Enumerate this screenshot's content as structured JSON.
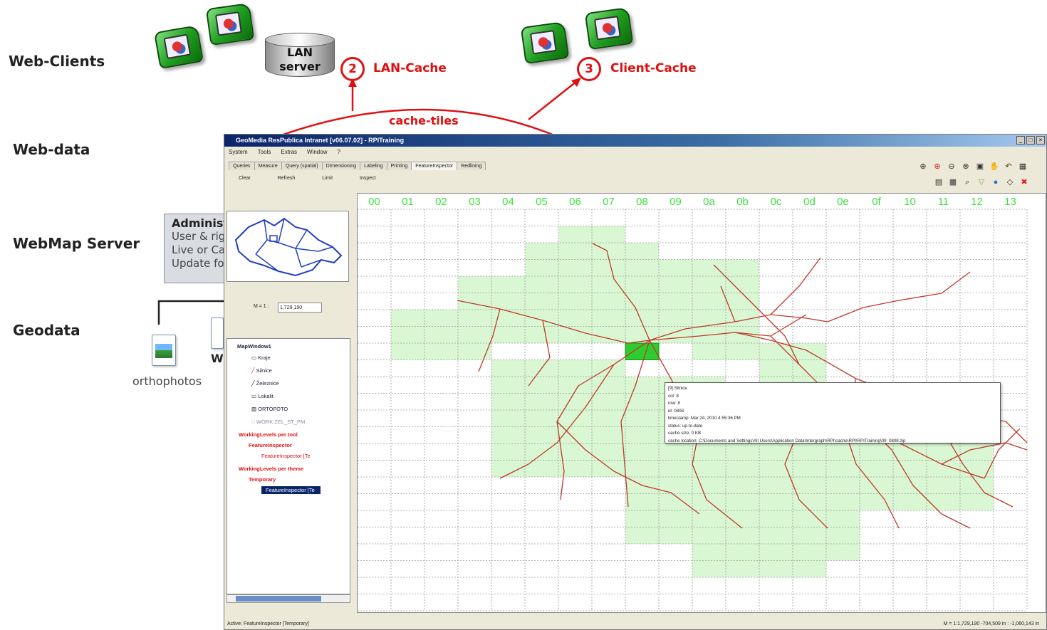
{
  "diagram": {
    "tiers": [
      "Web-Clients",
      "Web-data",
      "WebMap Server",
      "Geodata"
    ],
    "lan_server_label": [
      "LAN",
      "server"
    ],
    "cache_badges": [
      {
        "number": "2",
        "label": "LAN-Cache"
      },
      {
        "number": "3",
        "label": "Client-Cache"
      }
    ],
    "cache_tiles_label": "cache-tiles",
    "admin_box": {
      "title": "Administ",
      "lines": [
        "User & rig",
        "Live or Ca",
        "Update fo"
      ]
    },
    "orthophotos_label": "orthophotos",
    "wi_fragment": "Wi",
    "colors": {
      "accent_red": "#e01010",
      "client_green": "#20a020"
    }
  },
  "app": {
    "title": "GeoMedia ResPublica Intranet  [v06.07.02] - RPITraining",
    "window_buttons": [
      "_",
      "□",
      "×"
    ],
    "menu": [
      "System",
      "Tools",
      "Extras",
      "Window",
      "?"
    ],
    "tabs": [
      "Queries",
      "Measure",
      "Query (spatial)",
      "Dimensioning",
      "Labeling",
      "Printing",
      "FeatureInspector",
      "Redlining"
    ],
    "active_tab": "FeatureInspector",
    "subtools": [
      "Clear",
      "Refresh",
      "Limit",
      "Inspect"
    ],
    "toolbar_icons_row1": [
      "zoom-in-icon",
      "zoom-red-icon",
      "zoom-out-icon",
      "zoom-area-icon",
      "fit-window-icon",
      "pan-icon",
      "back-icon",
      "grid-icon"
    ],
    "toolbar_icons_row2": [
      "layers-icon",
      "table-icon",
      "search-icon",
      "filter-icon",
      "globe-icon",
      "select-icon",
      "close-icon"
    ],
    "scale_label": "M = 1 :",
    "scale_value": "1,729,190",
    "legend": {
      "root": "MapWindow1",
      "layers": [
        "Kraje",
        "Silnice",
        "Železnice",
        "Lokalit",
        "ORTOFOTO",
        "WORK ZEL_ST_PM"
      ],
      "group1": "WorkingLevels per tool",
      "group1_child": "FeatureInspector",
      "group1_leaf": "FeatureInspector [Te",
      "group2": "WorkingLevels per theme",
      "group2_child": "Temporary",
      "group2_leaf": "FeatureInspector [Te"
    },
    "status_left": "Active: FeatureInspector [Temporary]",
    "status_right": "M = 1:1,729,190    -704,509 in : -1,060,143 in",
    "grid_columns": [
      "00",
      "01",
      "02",
      "03",
      "04",
      "05",
      "06",
      "07",
      "08",
      "09",
      "0a",
      "0b",
      "0c",
      "0d",
      "0e",
      "0f",
      "10",
      "11",
      "12",
      "13"
    ],
    "tile_tooltip": [
      "[9] Silnice",
      "col: 8",
      "row: 8",
      "id: 0808",
      "timestamp: Mar 24, 2010 4:55:36 PM",
      "status: up-to-date",
      "cache size: 0 KB",
      "cache location: C:\\Documents and Settings\\All Users\\Application Data\\Intergraph\\RPI\\cache\\RPI\\RPITraining\\09_0808.zip"
    ],
    "colors": {
      "grid_label": "#3ee23e",
      "cached_tile": "#d8f7d2",
      "selected_tile": "#2ecc2e",
      "roads": "#c0392b",
      "region_border": "#1f3fbf"
    }
  }
}
